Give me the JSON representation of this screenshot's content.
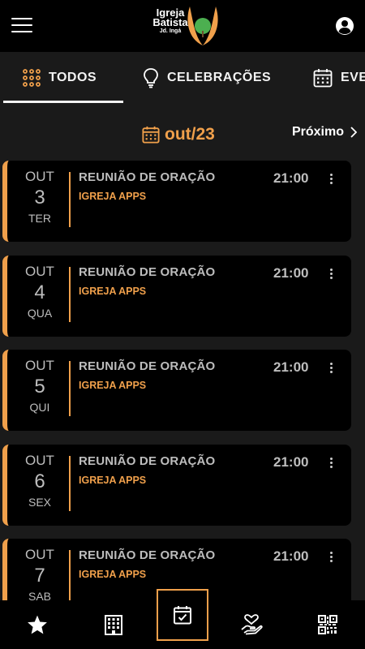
{
  "header": {
    "logo_line1": "Igreja",
    "logo_line2": "Batista",
    "logo_line3": "Jd. Ingá"
  },
  "tabs": [
    {
      "label": "TODOS",
      "icon": "grid-dots-icon",
      "selected": true
    },
    {
      "label": "CELEBRAÇÕES",
      "icon": "lightbulb-icon",
      "selected": false
    },
    {
      "label": "EVE",
      "icon": "calendar-icon",
      "selected": false
    }
  ],
  "month_nav": {
    "current": "out/23",
    "next_label": "Próximo"
  },
  "events": [
    {
      "month": "OUT",
      "day": "3",
      "weekday": "TER",
      "title": "REUNIÃO DE ORAÇÃO",
      "org": "IGREJA APPS",
      "time": "21:00"
    },
    {
      "month": "OUT",
      "day": "4",
      "weekday": "QUA",
      "title": "REUNIÃO DE ORAÇÃO",
      "org": "IGREJA APPS",
      "time": "21:00"
    },
    {
      "month": "OUT",
      "day": "5",
      "weekday": "QUI",
      "title": "REUNIÃO DE ORAÇÃO",
      "org": "IGREJA APPS",
      "time": "21:00"
    },
    {
      "month": "OUT",
      "day": "6",
      "weekday": "SEX",
      "title": "REUNIÃO DE ORAÇÃO",
      "org": "IGREJA APPS",
      "time": "21:00"
    },
    {
      "month": "OUT",
      "day": "7",
      "weekday": "SAB",
      "title": "REUNIÃO DE ORAÇÃO",
      "org": "IGREJA APPS",
      "time": "21:00"
    }
  ],
  "bottom_nav": [
    {
      "icon": "star-icon"
    },
    {
      "icon": "building-icon"
    },
    {
      "icon": "calendar-check-icon",
      "active": true
    },
    {
      "icon": "hand-heart-icon"
    },
    {
      "icon": "qr-code-icon"
    }
  ],
  "colors": {
    "accent": "#f0a04b",
    "background": "#1a1a1a",
    "card": "#000000",
    "text_muted": "#bdbdbd"
  }
}
